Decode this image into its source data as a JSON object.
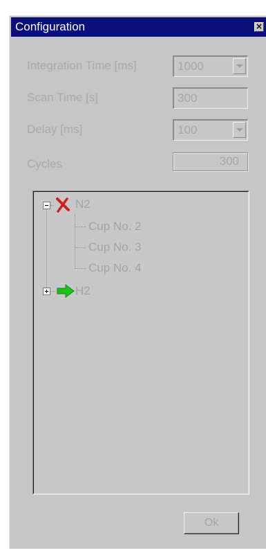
{
  "window": {
    "title": "Configuration",
    "close_glyph": "×"
  },
  "fields": {
    "integration_time": {
      "label": "Integration Time [ms]",
      "value": "1000"
    },
    "scan_time": {
      "label": "Scan Time [s]",
      "value": "300"
    },
    "delay": {
      "label": "Delay [ms]",
      "value": "100"
    },
    "cycles": {
      "label": "Cycles",
      "value": "300"
    }
  },
  "tree": {
    "nodes": [
      {
        "label": "N2",
        "expanded": true,
        "icon": "red-x-icon",
        "children": [
          "Cup No. 2",
          "Cup No. 3",
          "Cup No. 4"
        ]
      },
      {
        "label": "H2",
        "expanded": false,
        "icon": "green-arrow-icon",
        "children": []
      }
    ]
  },
  "buttons": {
    "ok_label": "Ok"
  },
  "colors": {
    "titlebar": "#0a0f7c",
    "dialog_bg": "#c6c6c6",
    "disabled_text": "#a9a9a9",
    "red_x": "#c82222",
    "green_arrow": "#1fc21f"
  }
}
